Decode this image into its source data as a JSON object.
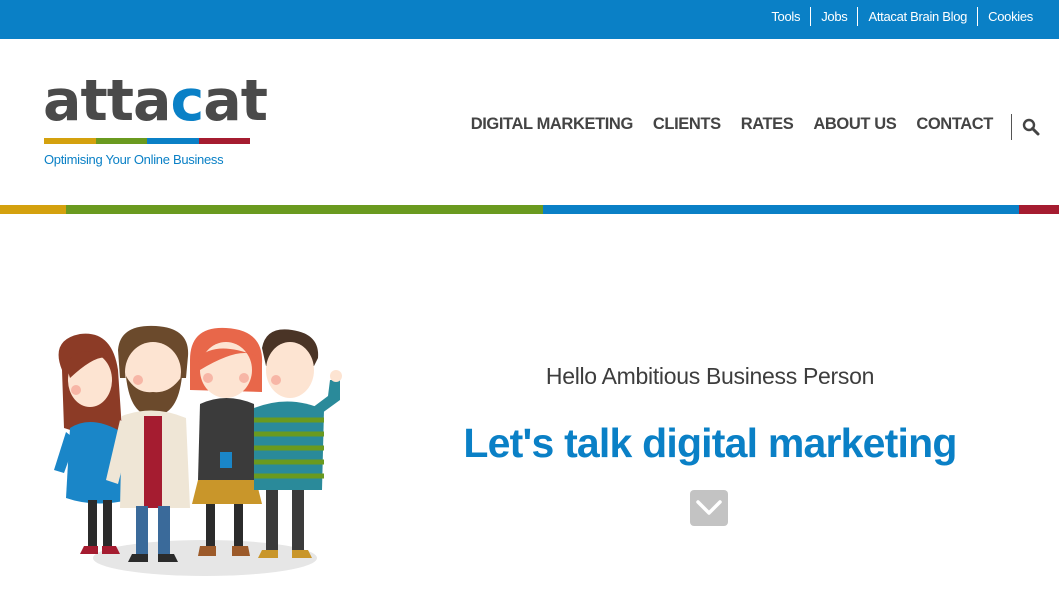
{
  "topbar": {
    "links": [
      "Tools",
      "Jobs",
      "Attacat Brain Blog",
      "Cookies"
    ]
  },
  "logo": {
    "word_main": "atta",
    "word_c": "c",
    "word_end": "at",
    "tagline": "Optimising Your Online Business",
    "stripe_colors": [
      "#d4a10e",
      "#6a9a1f",
      "#0a80c6",
      "#a51c30"
    ]
  },
  "nav": {
    "items": [
      "DIGITAL MARKETING",
      "CLIENTS",
      "RATES",
      "ABOUT US",
      "CONTACT"
    ],
    "search_icon": "search-icon"
  },
  "stripe": {
    "colors": [
      "#d4a10e",
      "#6a9a1f",
      "#0a80c6",
      "#a51c30"
    ]
  },
  "hero": {
    "greeting": "Hello Ambitious Business Person",
    "headline": "Let's talk digital marketing",
    "scroll_icon": "chevron-down-icon",
    "illustration": "team-illustration"
  },
  "colors": {
    "brand_blue": "#0a80c6",
    "text_dark": "#444444"
  }
}
